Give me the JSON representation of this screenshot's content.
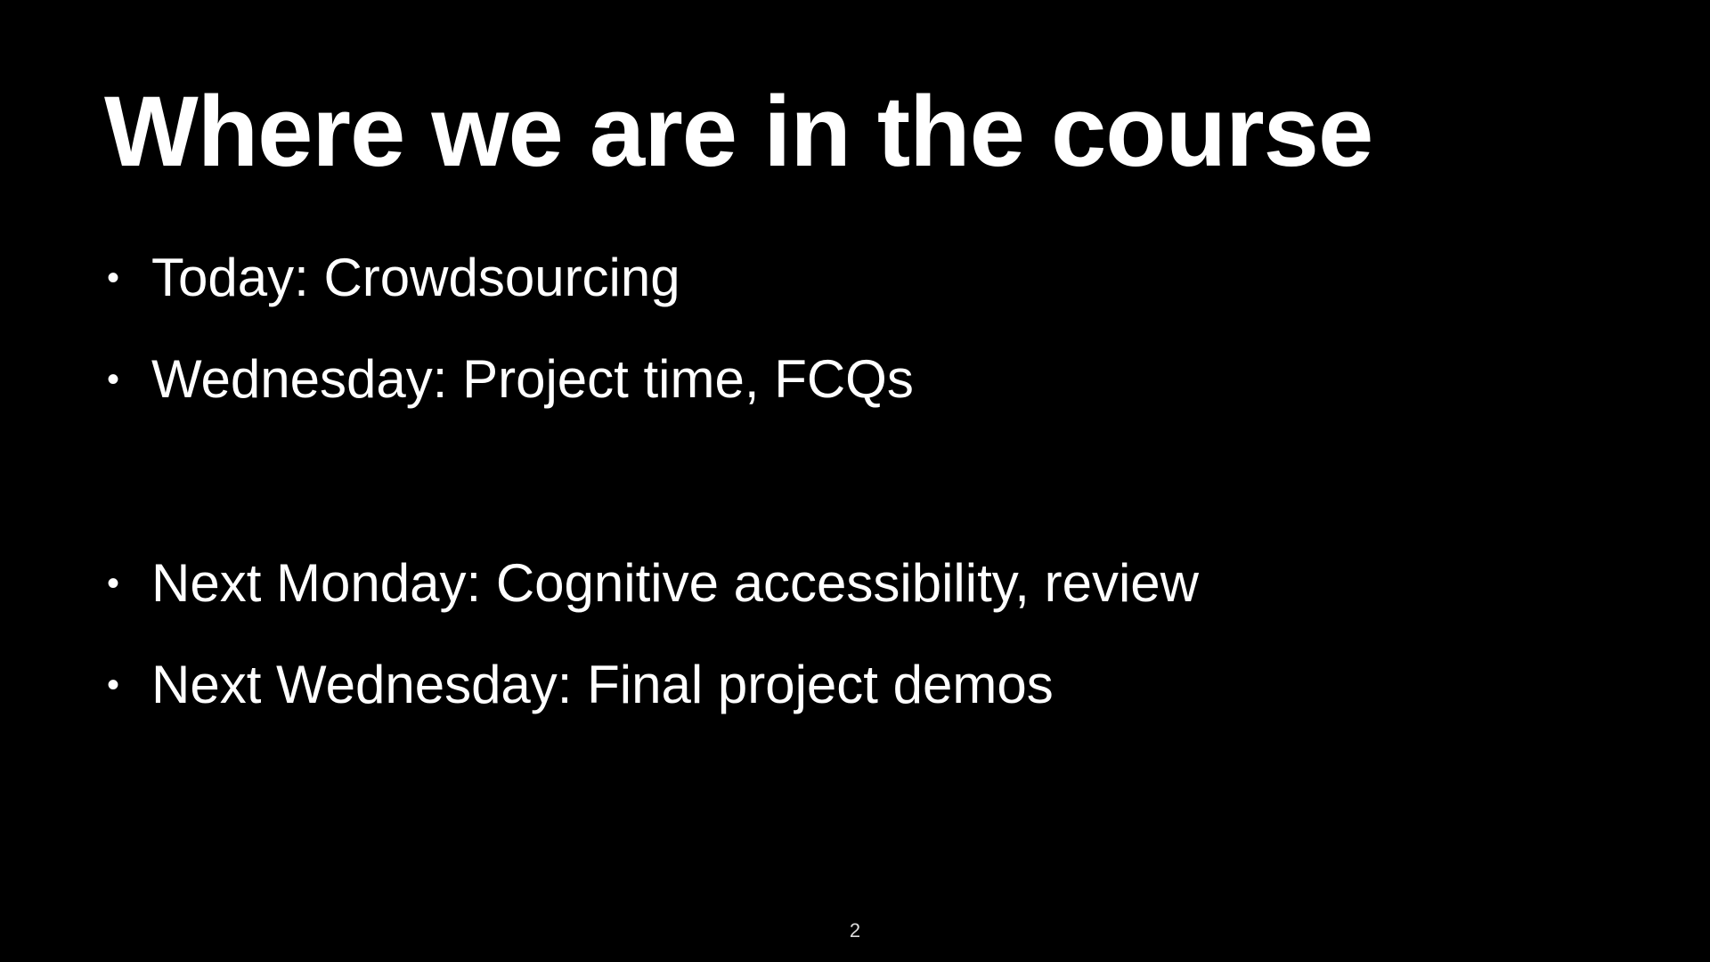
{
  "slide": {
    "title": "Where we are in the course",
    "bullets": [
      {
        "text": "Today: Crowdsourcing"
      },
      {
        "text": "Wednesday: Project time, FCQs"
      },
      {
        "text": "Next Monday: Cognitive accessibility, review"
      },
      {
        "text": "Next Wednesday: Final project demos"
      }
    ],
    "bullet_glyph": "•",
    "page_number": "2"
  }
}
